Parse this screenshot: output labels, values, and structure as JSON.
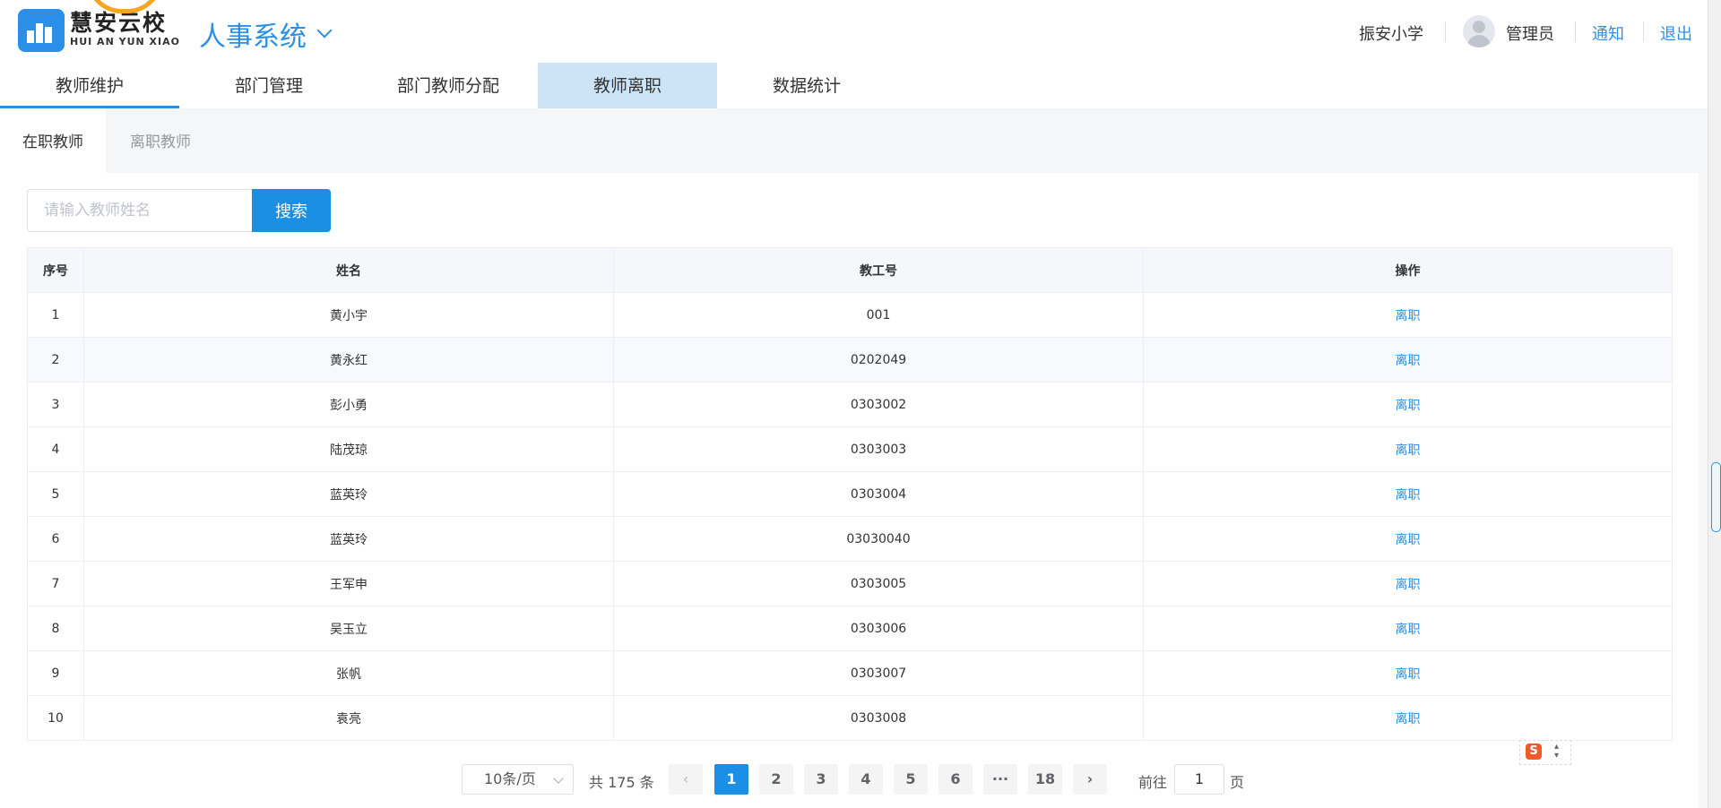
{
  "header": {
    "brand_cn": "慧安云校",
    "brand_en": "HUI AN YUN XIAO",
    "system_title": "人事系统",
    "school": "振安小学",
    "user": "管理员",
    "notice": "通知",
    "logout": "退出"
  },
  "nav": {
    "tabs": [
      "教师维护",
      "部门管理",
      "部门教师分配",
      "教师离职",
      "数据统计"
    ]
  },
  "subtabs": [
    "在职教师",
    "离职教师"
  ],
  "search": {
    "placeholder": "请输入教师姓名",
    "button": "搜索"
  },
  "table": {
    "headers": [
      "序号",
      "姓名",
      "教工号",
      "操作"
    ],
    "rows": [
      {
        "no": "1",
        "name": "黄小宇",
        "id": "001",
        "op": "离职"
      },
      {
        "no": "2",
        "name": "黄永红",
        "id": "0202049",
        "op": "离职"
      },
      {
        "no": "3",
        "name": "彭小勇",
        "id": "0303002",
        "op": "离职"
      },
      {
        "no": "4",
        "name": "陆茂琼",
        "id": "0303003",
        "op": "离职"
      },
      {
        "no": "5",
        "name": "蓝英玲",
        "id": "0303004",
        "op": "离职"
      },
      {
        "no": "6",
        "name": "蓝英玲",
        "id": "03030040",
        "op": "离职"
      },
      {
        "no": "7",
        "name": "王军申",
        "id": "0303005",
        "op": "离职"
      },
      {
        "no": "8",
        "name": "吴玉立",
        "id": "0303006",
        "op": "离职"
      },
      {
        "no": "9",
        "name": "张帆",
        "id": "0303007",
        "op": "离职"
      },
      {
        "no": "10",
        "name": "袁亮",
        "id": "0303008",
        "op": "离职"
      }
    ]
  },
  "pagination": {
    "page_size": "10条/页",
    "total": "共 175 条",
    "pages": [
      "1",
      "2",
      "3",
      "4",
      "5",
      "6",
      "···",
      "18"
    ],
    "current": "1",
    "prev": "‹",
    "next": "›",
    "goto_prefix": "前往",
    "goto_value": "1",
    "goto_suffix": "页"
  },
  "colors": {
    "accent": "#2b8fe7",
    "active_tab_bg": "#cde4f6",
    "button_bg": "#1a8fe3"
  }
}
